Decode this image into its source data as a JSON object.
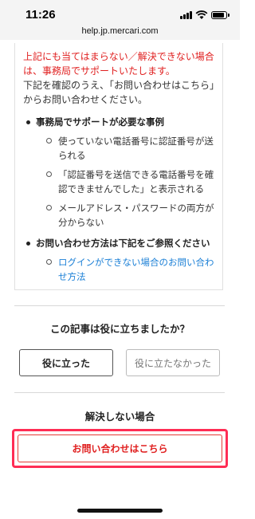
{
  "status_bar": {
    "time": "11:26"
  },
  "browser": {
    "url": "help.jp.mercari.com"
  },
  "article": {
    "warning_line": "上記にも当てはまらない／解決できない場合は、事務局でサポートいたします。",
    "instruction": "下記を確認のうえ、「お問い合わせはこちら」からお問い合わせください。",
    "sections": [
      {
        "heading": "事務局でサポートが必要な事例",
        "items": [
          "使っていない電話番号に認証番号が送られる",
          "「認証番号を送信できる電話番号を確認できませんでした」と表示される",
          "メールアドレス・パスワードの両方が分からない"
        ]
      },
      {
        "heading": "お問い合わせ方法は下記をご参照ください",
        "link": "ログインができない場合のお問い合わせ方法"
      }
    ]
  },
  "feedback": {
    "question": "この記事は役に立ちましたか？",
    "yes_label": "役に立った",
    "no_label": "役に立たなかった"
  },
  "unsolved": {
    "heading": "解決しない場合",
    "contact_label": "お問い合わせはこちら"
  },
  "colors": {
    "accent_red": "#e02020",
    "highlight": "#ff2d55",
    "link_blue": "#1a7fd6"
  }
}
